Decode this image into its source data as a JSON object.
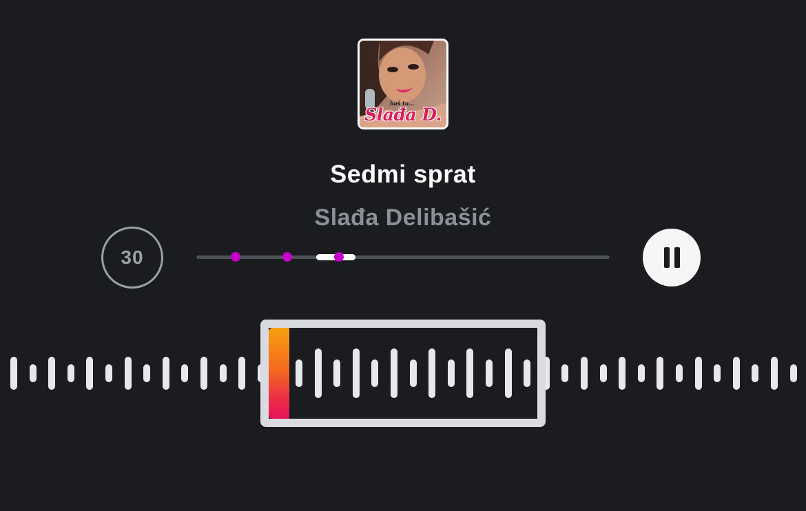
{
  "track": {
    "title": "Sedmi sprat",
    "artist": "Slađa Delibašić"
  },
  "album_art": {
    "cover_text": "Slađa D.",
    "cover_subtext": "baš to..."
  },
  "controls": {
    "skip_label": "30",
    "pause_icon": "pause-icon",
    "skip_icon": "skip-30-icon"
  },
  "scrubber": {
    "visible_window_start": 0.29,
    "visible_window_end": 0.385,
    "marker_positions": [
      0.095,
      0.22,
      0.345
    ]
  },
  "waveform": {
    "selection_start_fraction": 0.333,
    "selection_end_fraction": 0.677
  },
  "colors": {
    "background": "#1b1c20",
    "marker": "#c300c8",
    "playhead_top": "#f8a010",
    "playhead_bottom": "#e8125a",
    "waveform": "#e6e8ee",
    "selection_frame": "#d9dbe1"
  }
}
